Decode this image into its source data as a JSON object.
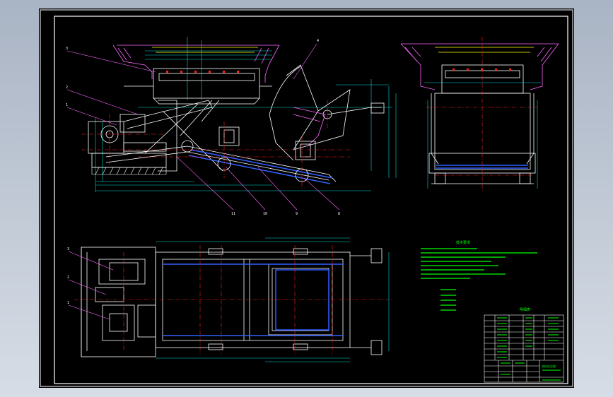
{
  "drawing": {
    "background": "#000000",
    "frame_color": "#ffffff",
    "colors": {
      "outline": "#ffffff",
      "centerline": "#ff2020",
      "dimension": "#00d8d8",
      "leader": "#ff33ff",
      "hidden": "#3060ff",
      "foundation": "#ff66ff",
      "notes": "#00ff00",
      "yellow": "#ffff00"
    },
    "views": [
      "front-view",
      "side-view",
      "plan-view",
      "technical-notes",
      "title-block"
    ],
    "callouts": {
      "front_left": [
        "3",
        "2",
        "1"
      ],
      "front_right": "4",
      "front_bottom": [
        "11",
        "10",
        "9",
        "8"
      ],
      "plan_left": [
        "3",
        "2",
        "1"
      ]
    },
    "notes_heading": "技术要求",
    "table_heading": "明细表",
    "title_text": "给料机总图"
  }
}
